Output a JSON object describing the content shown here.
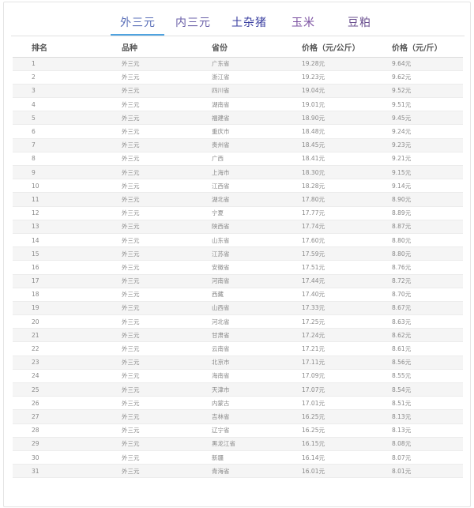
{
  "tabs": [
    {
      "label": "外三元",
      "active": true
    },
    {
      "label": "内三元",
      "active": false
    },
    {
      "label": "土杂猪",
      "active": false
    },
    {
      "label": "玉米",
      "active": false
    },
    {
      "label": "豆粕",
      "active": false
    }
  ],
  "colors": {
    "accent": "#4fa3e0",
    "active_tab": "#5a6fb8",
    "row_stripe": "#f5f5f5"
  },
  "table": {
    "headers": [
      "排名",
      "品种",
      "省份",
      "价格（元/公斤）",
      "价格（元/斤）"
    ],
    "rows": [
      [
        "1",
        "外三元",
        "广东省",
        "19.28元",
        "9.64元"
      ],
      [
        "2",
        "外三元",
        "浙江省",
        "19.23元",
        "9.62元"
      ],
      [
        "3",
        "外三元",
        "四川省",
        "19.04元",
        "9.52元"
      ],
      [
        "4",
        "外三元",
        "湖南省",
        "19.01元",
        "9.51元"
      ],
      [
        "5",
        "外三元",
        "福建省",
        "18.90元",
        "9.45元"
      ],
      [
        "6",
        "外三元",
        "重庆市",
        "18.48元",
        "9.24元"
      ],
      [
        "7",
        "外三元",
        "贵州省",
        "18.45元",
        "9.23元"
      ],
      [
        "8",
        "外三元",
        "广西",
        "18.41元",
        "9.21元"
      ],
      [
        "9",
        "外三元",
        "上海市",
        "18.30元",
        "9.15元"
      ],
      [
        "10",
        "外三元",
        "江西省",
        "18.28元",
        "9.14元"
      ],
      [
        "11",
        "外三元",
        "湖北省",
        "17.80元",
        "8.90元"
      ],
      [
        "12",
        "外三元",
        "宁夏",
        "17.77元",
        "8.89元"
      ],
      [
        "13",
        "外三元",
        "陕西省",
        "17.74元",
        "8.87元"
      ],
      [
        "14",
        "外三元",
        "山东省",
        "17.60元",
        "8.80元"
      ],
      [
        "15",
        "外三元",
        "江苏省",
        "17.59元",
        "8.80元"
      ],
      [
        "16",
        "外三元",
        "安徽省",
        "17.51元",
        "8.76元"
      ],
      [
        "17",
        "外三元",
        "河南省",
        "17.44元",
        "8.72元"
      ],
      [
        "18",
        "外三元",
        "西藏",
        "17.40元",
        "8.70元"
      ],
      [
        "19",
        "外三元",
        "山西省",
        "17.33元",
        "8.67元"
      ],
      [
        "20",
        "外三元",
        "河北省",
        "17.25元",
        "8.63元"
      ],
      [
        "21",
        "外三元",
        "甘肃省",
        "17.24元",
        "8.62元"
      ],
      [
        "22",
        "外三元",
        "云南省",
        "17.21元",
        "8.61元"
      ],
      [
        "23",
        "外三元",
        "北京市",
        "17.11元",
        "8.56元"
      ],
      [
        "24",
        "外三元",
        "海南省",
        "17.09元",
        "8.55元"
      ],
      [
        "25",
        "外三元",
        "天津市",
        "17.07元",
        "8.54元"
      ],
      [
        "26",
        "外三元",
        "内蒙古",
        "17.01元",
        "8.51元"
      ],
      [
        "27",
        "外三元",
        "吉林省",
        "16.25元",
        "8.13元"
      ],
      [
        "28",
        "外三元",
        "辽宁省",
        "16.25元",
        "8.13元"
      ],
      [
        "29",
        "外三元",
        "黑龙江省",
        "16.15元",
        "8.08元"
      ],
      [
        "30",
        "外三元",
        "新疆",
        "16.14元",
        "8.07元"
      ],
      [
        "31",
        "外三元",
        "青海省",
        "16.01元",
        "8.01元"
      ]
    ]
  }
}
